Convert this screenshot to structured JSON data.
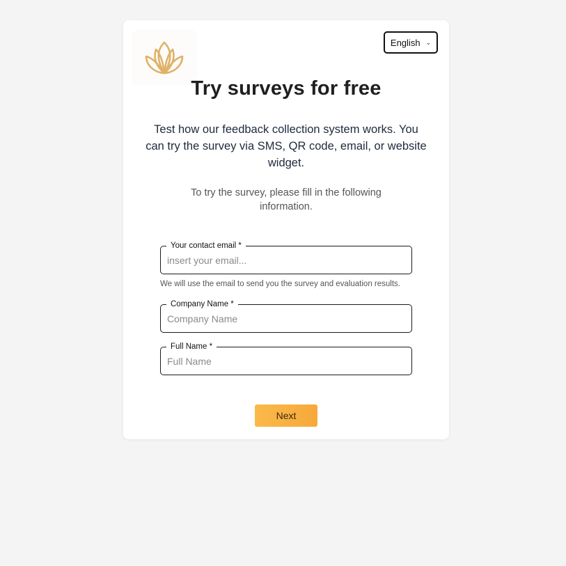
{
  "brand": {
    "logo_icon": "lotus-icon",
    "accent_color": "#dfb268"
  },
  "language": {
    "selected": "English",
    "icon": "chevron-down-icon"
  },
  "header": {
    "title": "Try surveys for free",
    "subtitle": "Test how our feedback collection system works. You can try the survey via SMS, QR code, email, or website widget.",
    "note": "To try the survey, please fill in the following information."
  },
  "form": {
    "email": {
      "label": "Your contact email *",
      "placeholder": "insert your email...",
      "value": "",
      "helper": "We will use the email to send you the survey and evaluation results."
    },
    "company": {
      "label": "Company Name *",
      "placeholder": "Company Name",
      "value": ""
    },
    "full_name": {
      "label": "Full Name *",
      "placeholder": "Full Name",
      "value": ""
    },
    "next_label": "Next",
    "button_color": "#f8b040"
  }
}
